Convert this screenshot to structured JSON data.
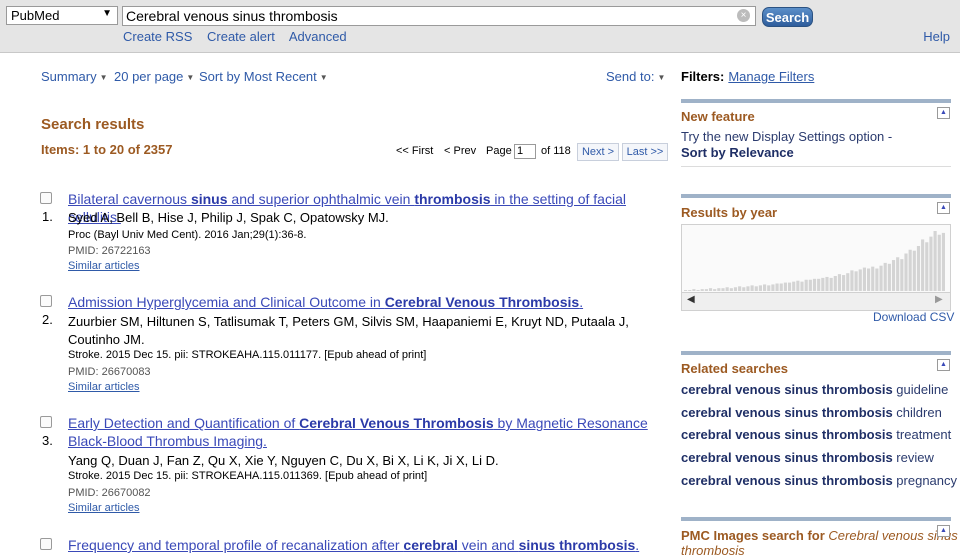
{
  "search": {
    "database": "PubMed",
    "query": "Cerebral venous sinus thrombosis",
    "button": "Search",
    "links": [
      "Create RSS",
      "Create alert",
      "Advanced"
    ],
    "help": "Help"
  },
  "controls": {
    "summary": "Summary",
    "per_page": "20 per page",
    "sort": "Sort by Most Recent",
    "send_to": "Send to:"
  },
  "results_heading": "Search results",
  "items_count": "Items: 1 to 20 of 2357",
  "pager": {
    "first": "<< First",
    "prev": "< Prev",
    "page_label": "Page",
    "page_value": "1",
    "of_label": "of 118",
    "next": "Next >",
    "last": "Last >>"
  },
  "results": [
    {
      "num": "1.",
      "title_parts": [
        [
          "Bilateral cavernous ",
          false
        ],
        [
          "sinus",
          true
        ],
        [
          " and superior ophthalmic vein ",
          false
        ],
        [
          "thrombosis",
          true
        ],
        [
          " in the setting of facial cellulitis.",
          false
        ]
      ],
      "authors": "Syed A, Bell B, Hise J, Philip J, Spak C, Opatowsky MJ.",
      "journal": "Proc (Bayl Univ Med Cent). 2016 Jan;29(1):36-8.",
      "pmid": "PMID: 26722163",
      "similar": "Similar articles"
    },
    {
      "num": "2.",
      "title_parts": [
        [
          "Admission Hyperglycemia and Clinical Outcome in ",
          false
        ],
        [
          "Cerebral Venous Thrombosis",
          true
        ],
        [
          ".",
          false
        ]
      ],
      "authors": "Zuurbier SM, Hiltunen S, Tatlisumak T, Peters GM, Silvis SM, Haapaniemi E, Kruyt ND, Putaala J, Coutinho JM.",
      "journal": "Stroke. 2015 Dec 15. pii: STROKEAHA.115.011177. [Epub ahead of print]",
      "pmid": "PMID: 26670083",
      "similar": "Similar articles"
    },
    {
      "num": "3.",
      "title_parts": [
        [
          "Early Detection and Quantification of ",
          false
        ],
        [
          "Cerebral Venous Thrombosis",
          true
        ],
        [
          " by Magnetic Resonance Black-Blood Thrombus Imaging.",
          false
        ]
      ],
      "authors": "Yang Q, Duan J, Fan Z, Qu X, Xie Y, Nguyen C, Du X, Bi X, Li K, Ji X, Li D.",
      "journal": "Stroke. 2015 Dec 15. pii: STROKEAHA.115.011369. [Epub ahead of print]",
      "pmid": "PMID: 26670082",
      "similar": "Similar articles"
    },
    {
      "num": "4.",
      "title_parts": [
        [
          "Frequency and temporal profile of recanalization after ",
          false
        ],
        [
          "cerebral",
          true
        ],
        [
          " vein and ",
          false
        ],
        [
          "sinus thrombosis",
          true
        ],
        [
          ".",
          false
        ]
      ]
    }
  ],
  "sidebar": {
    "filters_label": "Filters:",
    "manage_filters": "Manage Filters",
    "new_feature_title": "New feature",
    "new_feature_text": "Try the new Display Settings option -",
    "new_feature_bold": "Sort by Relevance",
    "results_by_year_title": "Results by year",
    "year_counts": [
      1,
      1,
      2,
      1,
      2,
      2,
      3,
      2,
      3,
      3,
      4,
      3,
      4,
      5,
      4,
      5,
      6,
      5,
      6,
      7,
      6,
      7,
      8,
      8,
      9,
      9,
      10,
      11,
      10,
      12,
      12,
      13,
      13,
      14,
      15,
      14,
      16,
      18,
      17,
      19,
      22,
      21,
      23,
      25,
      24,
      26,
      24,
      27,
      30,
      29,
      33,
      36,
      34,
      40,
      44,
      43,
      48,
      55,
      52,
      58,
      64,
      60,
      62
    ],
    "download_csv": "Download CSV",
    "related_title": "Related searches",
    "related": [
      [
        "cerebral venous sinus thrombosis",
        "guideline"
      ],
      [
        "cerebral venous sinus thrombosis",
        "children"
      ],
      [
        "cerebral venous sinus thrombosis",
        "treatment"
      ],
      [
        "cerebral venous sinus thrombosis",
        "review"
      ],
      [
        "cerebral venous sinus thrombosis",
        "pregnancy"
      ]
    ],
    "pmc_title_prefix": "PMC Images search for",
    "pmc_title_query": "Cerebral venous sinus thrombosis"
  },
  "colors": {
    "accent_brown": "#9c5a22",
    "link_blue": "#2f5aa8",
    "title_blue": "#3a49b8"
  }
}
